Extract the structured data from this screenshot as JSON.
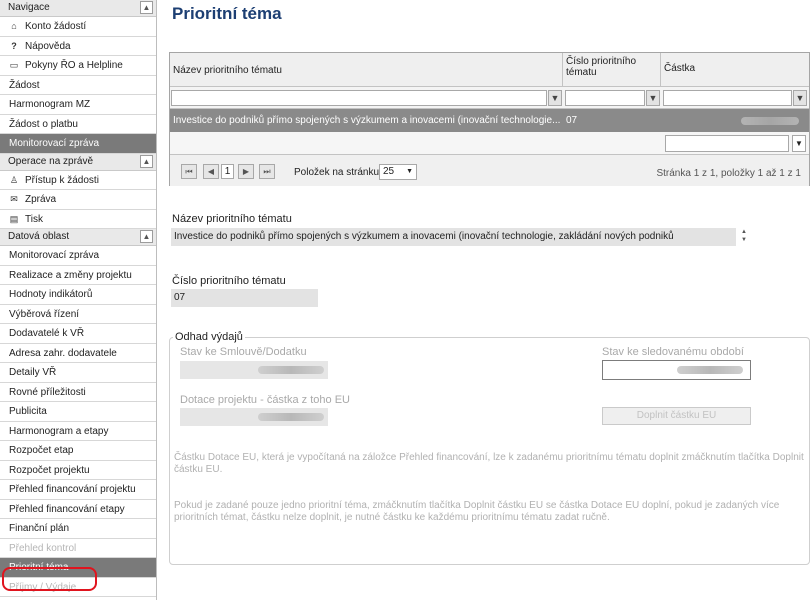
{
  "sidebar": {
    "nav_header": "Navigace",
    "nav_items": [
      {
        "label": "Konto žádostí",
        "icon": "home-icon"
      },
      {
        "label": "Nápověda",
        "icon": "question-icon"
      },
      {
        "label": "Pokyny ŘO a Helpline",
        "icon": "book-icon"
      }
    ],
    "plain_items": [
      "Žádost",
      "Harmonogram MZ",
      "Žádost o platbu"
    ],
    "active_item": "Monitorovací zpráva",
    "ops_header": "Operace na zprávě",
    "ops_items": [
      {
        "label": "Přístup k žádosti",
        "icon": "user-icon"
      },
      {
        "label": "Zpráva",
        "icon": "mail-icon"
      },
      {
        "label": "Tisk",
        "icon": "printer-icon"
      }
    ],
    "data_header": "Datová oblast",
    "data_items": [
      "Monitorovací zpráva",
      "Realizace a změny projektu",
      "Hodnoty indikátorů",
      "Výběrová řízení",
      "Dodavatelé k VŘ",
      "Adresa zahr. dodavatele",
      "Detaily VŘ",
      "Rovné příležitosti",
      "Publicita",
      "Harmonogram a etapy",
      "Rozpočet etap",
      "Rozpočet projektu",
      "Přehled financování projektu",
      "Přehled financování etapy",
      "Finanční plán"
    ],
    "disabled_item": "Přehled kontrol",
    "selected_item": "Prioritní téma",
    "last_item": "Příjmy / Výdaje",
    "collapse_symbol": "▲"
  },
  "page": {
    "title": "Prioritní téma"
  },
  "grid": {
    "columns": [
      "Název prioritního tématu",
      "Číslo prioritního tématu",
      "Částka"
    ],
    "rows": [
      {
        "name": "Investice do podniků přímo spojených s výzkumem a inovacemi (inovační technologie...",
        "number": "07",
        "amount": ""
      }
    ],
    "filter_icon": "funnel-icon",
    "pager": {
      "first": "⏮",
      "prev": "◀",
      "next": "▶",
      "last": "⏭",
      "page": "1",
      "items_per_page_label": "Položek na stránku",
      "page_size": "25",
      "info": "Stránka 1 z 1, položky 1 až 1 z 1"
    }
  },
  "detail": {
    "name_label": "Název prioritního tématu",
    "name_value": "Investice do podniků přímo spojených s výzkumem a inovacemi (inovační technologie, zakládání nových podniků",
    "number_label": "Číslo prioritního tématu",
    "number_value": "07"
  },
  "estimate": {
    "legend": "Odhad výdajů",
    "contract_state_label": "Stav ke Smlouvě/Dodatku",
    "monitored_state_label": "Stav ke sledovanému období",
    "eu_share_label": "Dotace projektu - částka z toho EU",
    "fill_button": "Doplnit částku EU",
    "note1": "Částku Dotace EU, která je vypočítaná na záložce Přehled financování, lze k zadanému prioritnímu tématu doplnit zmáčknutím tlačítka Doplnit částku EU.",
    "note2": "Pokud je zadané pouze jedno prioritní téma, zmáčknutím tlačítka Doplnit částku EU se částka Dotace EU doplní, pokud je zadaných více prioritních témat, částku nelze doplnit, je nutné částku ke každému prioritnímu tématu zadat ručně."
  }
}
